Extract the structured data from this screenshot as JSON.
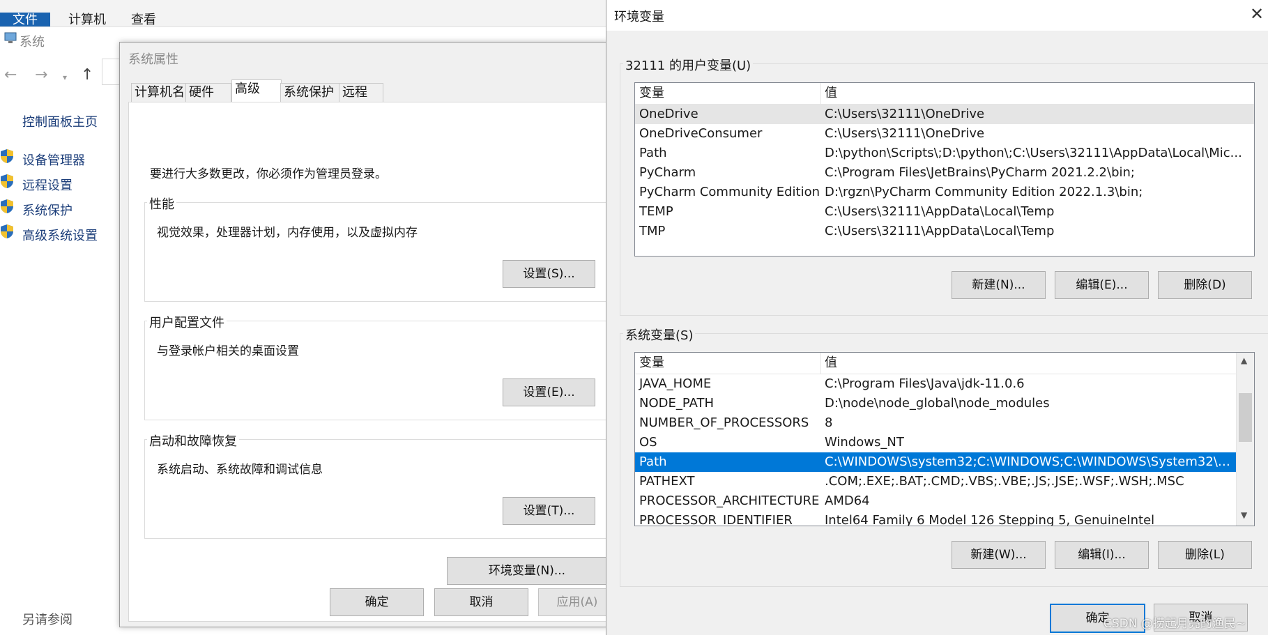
{
  "explorer": {
    "ribbon_tabs": [
      "文件",
      "计算机",
      "查看"
    ],
    "address": "系统",
    "sidebar_home": "控制面板主页",
    "sidebar_links": [
      "设备管理器",
      "远程设置",
      "系统保护",
      "高级系统设置"
    ],
    "see_also": "另请参阅"
  },
  "sysprops": {
    "title": "系统属性",
    "tabs": [
      "计算机名",
      "硬件",
      "高级",
      "系统保护",
      "远程"
    ],
    "admin_note": "要进行大多数更改，你必须作为管理员登录。",
    "groups": [
      {
        "label": "性能",
        "desc": "视觉效果，处理器计划，内存使用，以及虚拟内存",
        "button": "设置(S)..."
      },
      {
        "label": "用户配置文件",
        "desc": "与登录帐户相关的桌面设置",
        "button": "设置(E)..."
      },
      {
        "label": "启动和故障恢复",
        "desc": "系统启动、系统故障和调试信息",
        "button": "设置(T)..."
      }
    ],
    "env_button": "环境变量(N)...",
    "ok": "确定",
    "cancel": "取消",
    "apply": "应用(A)"
  },
  "envdlg": {
    "title": "环境变量",
    "user_group_label": "32111 的用户变量(U)",
    "col_var": "变量",
    "col_val": "值",
    "user_rows": [
      {
        "name": "OneDrive",
        "value": "C:\\Users\\32111\\OneDrive"
      },
      {
        "name": "OneDriveConsumer",
        "value": "C:\\Users\\32111\\OneDrive"
      },
      {
        "name": "Path",
        "value": "D:\\python\\Scripts\\;D:\\python\\;C:\\Users\\32111\\AppData\\Local\\Mic..."
      },
      {
        "name": "PyCharm",
        "value": "C:\\Program Files\\JetBrains\\PyCharm 2021.2.2\\bin;"
      },
      {
        "name": "PyCharm Community Edition",
        "value": "D:\\rgzn\\PyCharm Community Edition 2022.1.3\\bin;"
      },
      {
        "name": "TEMP",
        "value": "C:\\Users\\32111\\AppData\\Local\\Temp"
      },
      {
        "name": "TMP",
        "value": "C:\\Users\\32111\\AppData\\Local\\Temp"
      }
    ],
    "user_buttons": [
      "新建(N)...",
      "编辑(E)...",
      "删除(D)"
    ],
    "sys_group_label": "系统变量(S)",
    "sys_rows": [
      {
        "name": "JAVA_HOME",
        "value": "C:\\Program Files\\Java\\jdk-11.0.6"
      },
      {
        "name": "NODE_PATH",
        "value": "D:\\node\\node_global\\node_modules"
      },
      {
        "name": "NUMBER_OF_PROCESSORS",
        "value": "8"
      },
      {
        "name": "OS",
        "value": "Windows_NT"
      },
      {
        "name": "Path",
        "value": "C:\\WINDOWS\\system32;C:\\WINDOWS;C:\\WINDOWS\\System32\\W..."
      },
      {
        "name": "PATHEXT",
        "value": ".COM;.EXE;.BAT;.CMD;.VBS;.VBE;.JS;.JSE;.WSF;.WSH;.MSC"
      },
      {
        "name": "PROCESSOR_ARCHITECTURE",
        "value": "AMD64"
      },
      {
        "name": "PROCESSOR_IDENTIFIER",
        "value": "Intel64 Family 6 Model 126 Stepping 5, GenuineIntel"
      }
    ],
    "sys_buttons": [
      "新建(W)...",
      "编辑(I)...",
      "删除(L)"
    ],
    "ok": "确定",
    "cancel": "取消"
  },
  "watermark": "CSDN @捞起月亮的渔民~",
  "colors": {
    "selection": "#0078d7",
    "file_tab": "#1a63b0",
    "link": "#1c3e7a"
  }
}
